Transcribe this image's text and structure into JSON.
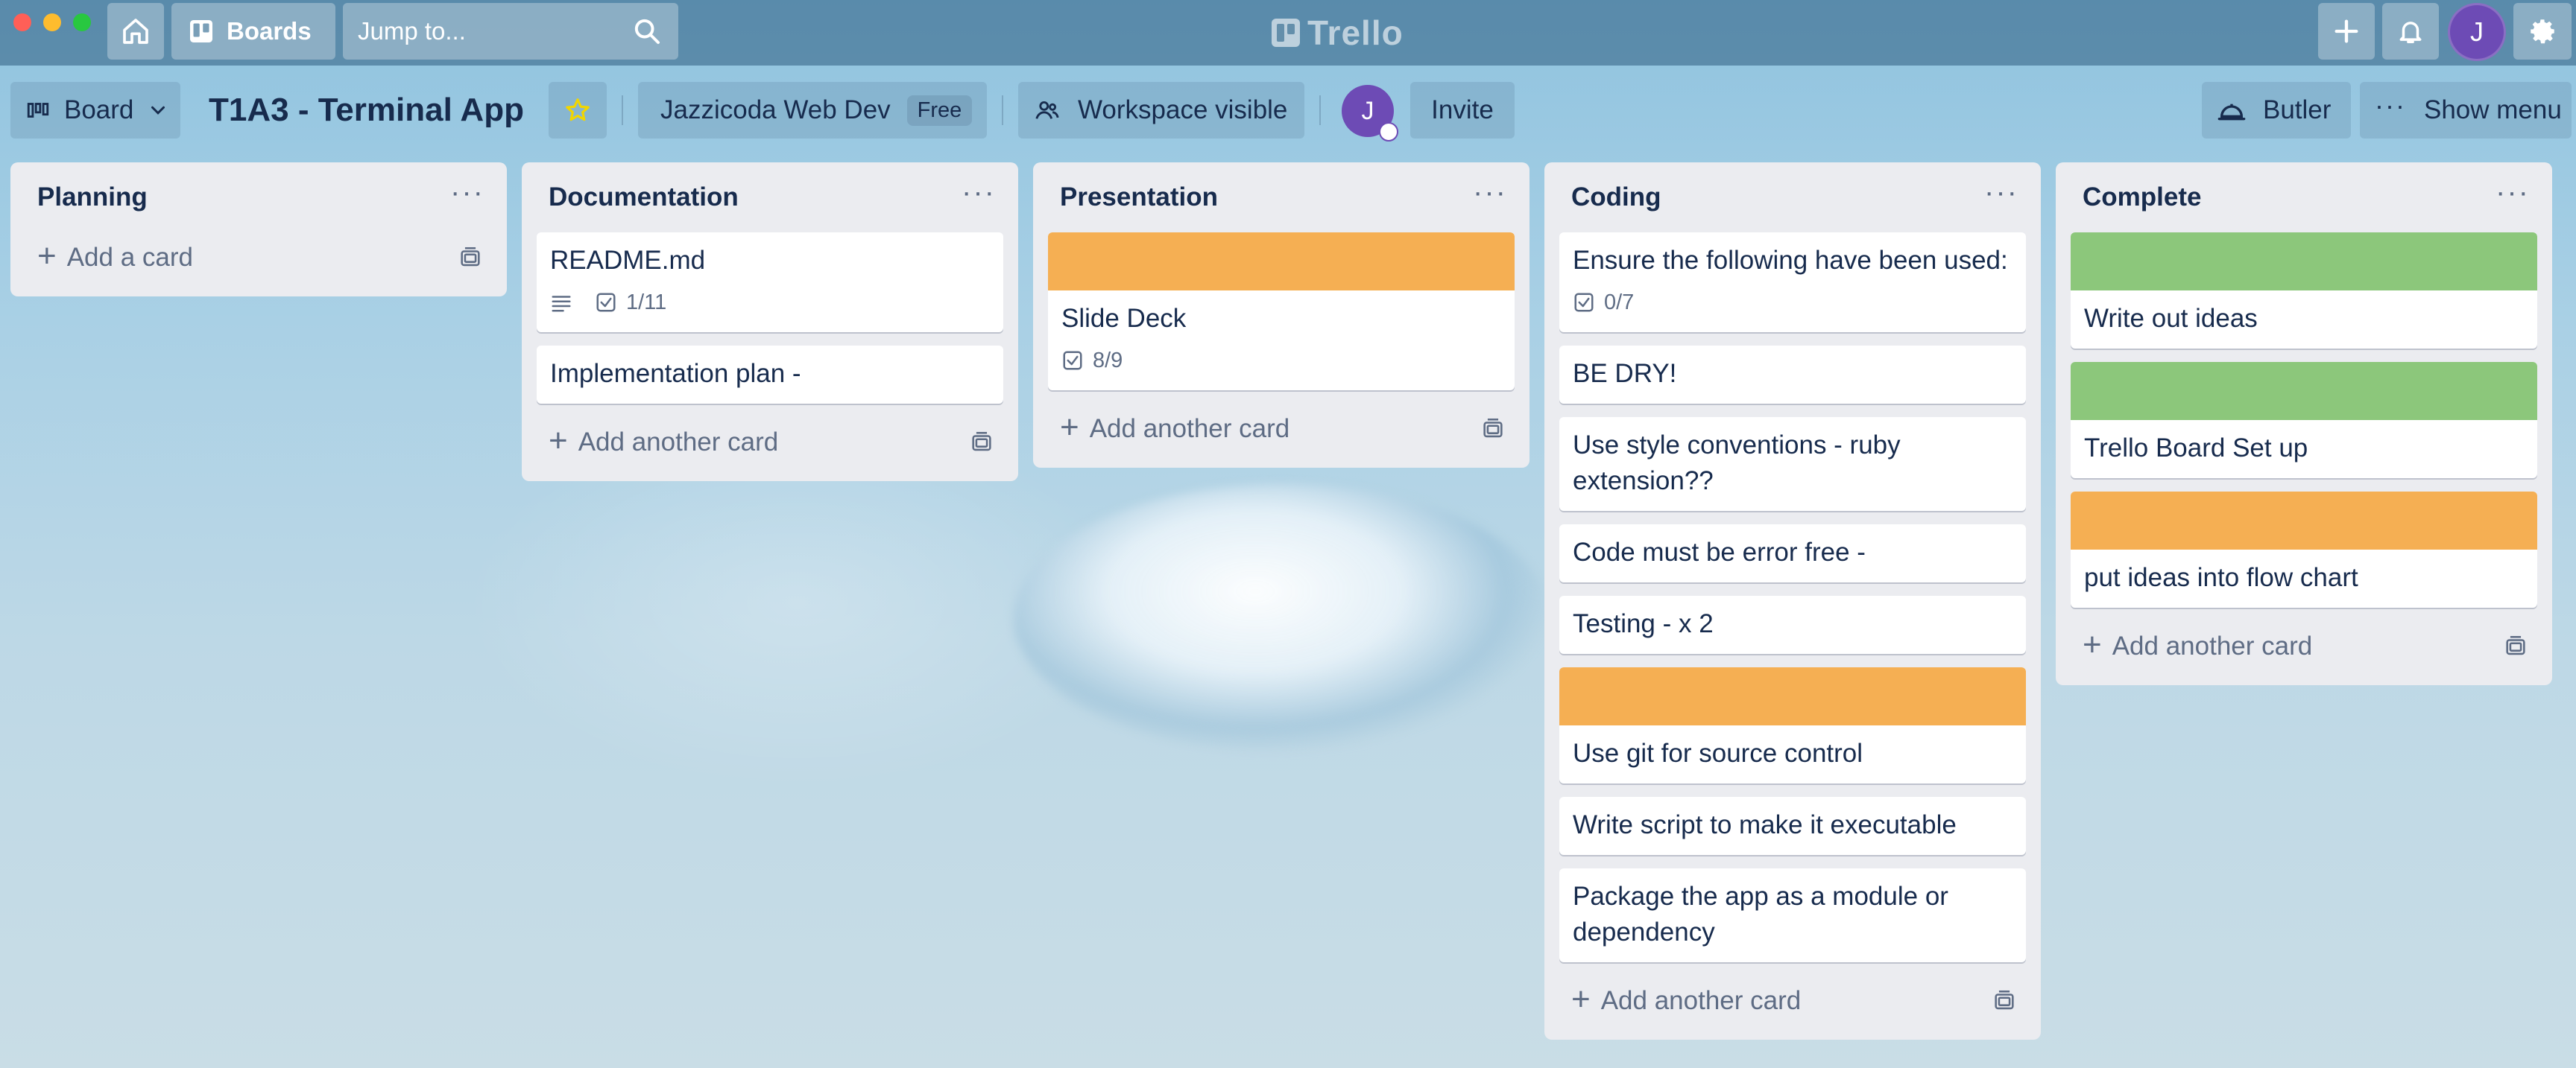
{
  "window": {
    "controls": [
      "close",
      "minimize",
      "zoom"
    ]
  },
  "topbar": {
    "boards_label": "Boards",
    "search_placeholder": "Jump to...",
    "logo_text": "Trello",
    "avatar_initial": "J"
  },
  "board_header": {
    "view_label": "Board",
    "title": "T1A3 - Terminal App",
    "workspace_name": "Jazzicoda Web Dev",
    "workspace_plan": "Free",
    "visibility_label": "Workspace visible",
    "member_initial": "J",
    "invite_label": "Invite",
    "butler_label": "Butler",
    "show_menu_label": "Show menu"
  },
  "lists": [
    {
      "title": "Planning",
      "cards": [],
      "add_label": "Add a card"
    },
    {
      "title": "Documentation",
      "cards": [
        {
          "title": "README.md",
          "has_description": true,
          "checklist": "1/11"
        },
        {
          "title": "Implementation plan -"
        }
      ],
      "add_label": "Add another card"
    },
    {
      "title": "Presentation",
      "cards": [
        {
          "title": "Slide Deck",
          "cover": "#f5af53",
          "checklist": "8/9"
        }
      ],
      "add_label": "Add another card"
    },
    {
      "title": "Coding",
      "cards": [
        {
          "title": "Ensure the following have been used:",
          "checklist": "0/7"
        },
        {
          "title": "BE DRY!"
        },
        {
          "title": "Use style conventions - ruby extension??"
        },
        {
          "title": "Code must be error free -"
        },
        {
          "title": "Testing - x 2"
        },
        {
          "title": "Use git for source control",
          "cover": "#f5af53"
        },
        {
          "title": "Write script to make it executable"
        },
        {
          "title": "Package the app as a module or dependency"
        }
      ],
      "add_label": "Add another card"
    },
    {
      "title": "Complete",
      "cards": [
        {
          "title": "Write out ideas",
          "cover": "#8cc77b"
        },
        {
          "title": "Trello Board Set up",
          "cover": "#8cc77b"
        },
        {
          "title": "put ideas into flow chart",
          "cover": "#f5af53"
        }
      ],
      "add_label": "Add another card"
    }
  ],
  "colors": {
    "orange_cover": "#f5af53",
    "green_cover": "#8cc77b",
    "avatar": "#6d4bb5"
  }
}
